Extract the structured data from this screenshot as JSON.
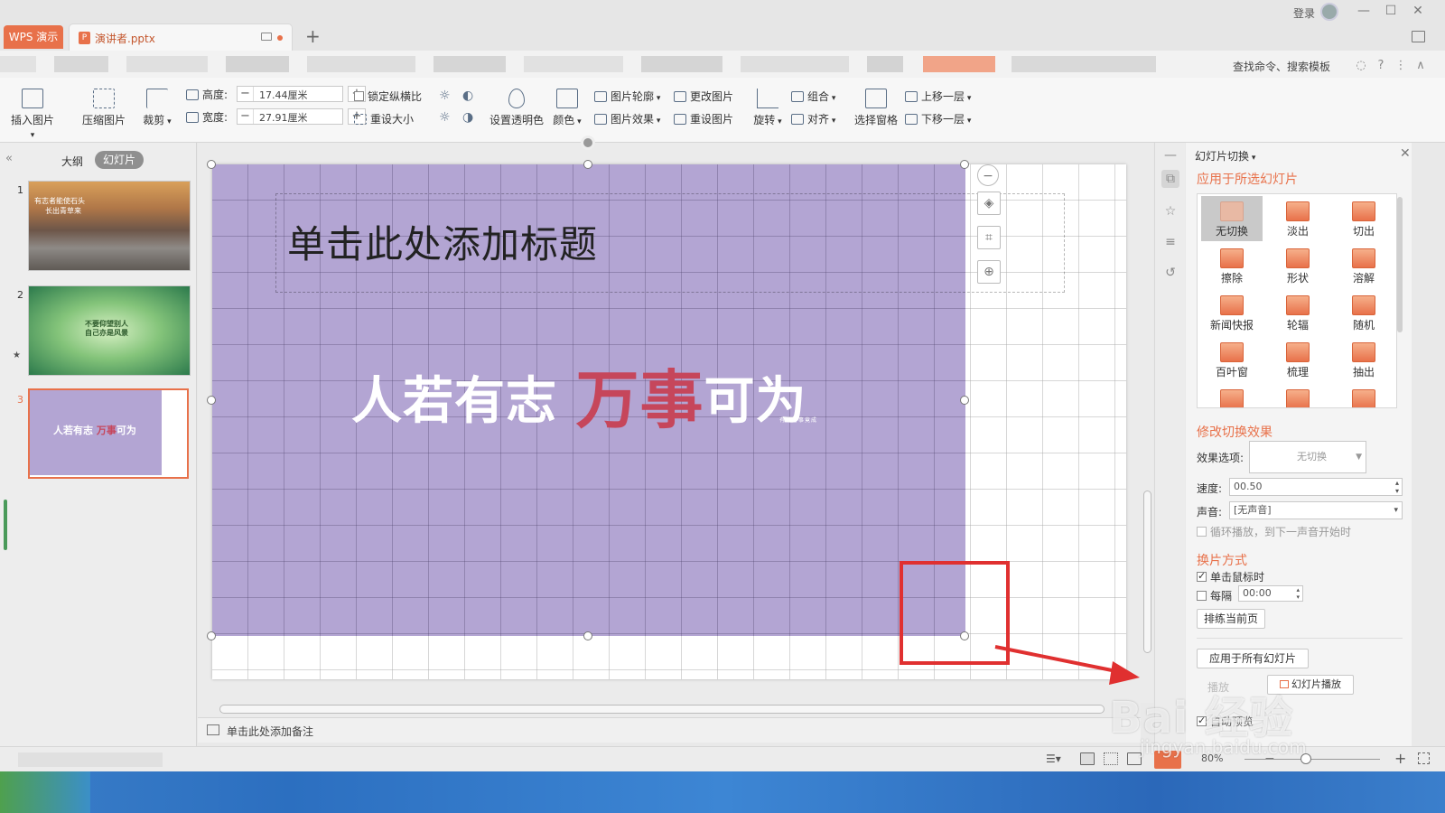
{
  "titlebar": {
    "app_tab": "WPS 演示",
    "doc_tab": "演讲者.pptx",
    "login": "登录"
  },
  "menurow": {
    "search": "查找命令、搜索模板"
  },
  "ribbon": {
    "insert_picture": "插入图片",
    "compress_picture": "压缩图片",
    "crop": "裁剪",
    "height_label": "高度:",
    "height_value": "17.44厘米",
    "width_label": "宽度:",
    "width_value": "27.91厘米",
    "lock_ratio": "锁定纵横比",
    "reset_size": "重设大小",
    "set_transparent": "设置透明色",
    "color": "颜色",
    "picture_outline": "图片轮廓",
    "picture_effect": "图片效果",
    "change_picture": "更改图片",
    "reset_picture": "重设图片",
    "rotate": "旋转",
    "group": "组合",
    "align": "对齐",
    "selection_pane": "选择窗格",
    "bring_forward": "上移一层",
    "send_backward": "下移一层"
  },
  "leftpanel": {
    "tab_outline": "大纲",
    "tab_slides": "幻灯片",
    "slides": [
      {
        "num": "1",
        "text_a": "有志者能使石头",
        "text_b": "长出青草来"
      },
      {
        "num": "2",
        "text_a": "不要仰望别人",
        "text_b": "自己亦是风景"
      },
      {
        "num": "3",
        "text_w1": "人若有志",
        "text_r": "万事",
        "text_w2": "可为"
      }
    ]
  },
  "slide": {
    "title_placeholder": "单击此处添加标题",
    "motto_w1": "人若有志",
    "motto_r": "万事",
    "motto_w2": "可为",
    "motto_tiny": "有志者事竟成"
  },
  "notes": {
    "placeholder": "单击此处添加备注"
  },
  "rightpanel": {
    "title": "幻灯片切换",
    "section_apply": "应用于所选幻灯片",
    "transitions": [
      "无切换",
      "淡出",
      "切出",
      "擦除",
      "形状",
      "溶解",
      "新闻快报",
      "轮辐",
      "随机",
      "百叶窗",
      "梳理",
      "抽出",
      "",
      "",
      ""
    ],
    "section_modify": "修改切换效果",
    "effect_label": "效果选项:",
    "effect_value": "无切换",
    "speed_label": "速度:",
    "speed_value": "00.50",
    "sound_label": "声音:",
    "sound_value": "[无声音]",
    "loop_label": "循环播放，到下一声音开始时",
    "section_advance": "换片方式",
    "on_click_label": "单击鼠标时",
    "on_click_checked": true,
    "every_label": "每隔",
    "every_value": "00:00",
    "rehearse_button": "排练当前页",
    "apply_all_button": "应用于所有幻灯片",
    "play_label": "播放",
    "slideshow_button": "幻灯片播放",
    "autopreview_label": "自动预览"
  },
  "statusbar": {
    "zoom": "80%"
  },
  "watermark": {
    "big": "Bai 经验",
    "small": "jingyan.baidu.com"
  },
  "colors": {
    "accent": "#e8714a",
    "picture_fill": "#b3a5d3",
    "highlight_red": "#e03030",
    "motto_red": "#c6465b"
  }
}
